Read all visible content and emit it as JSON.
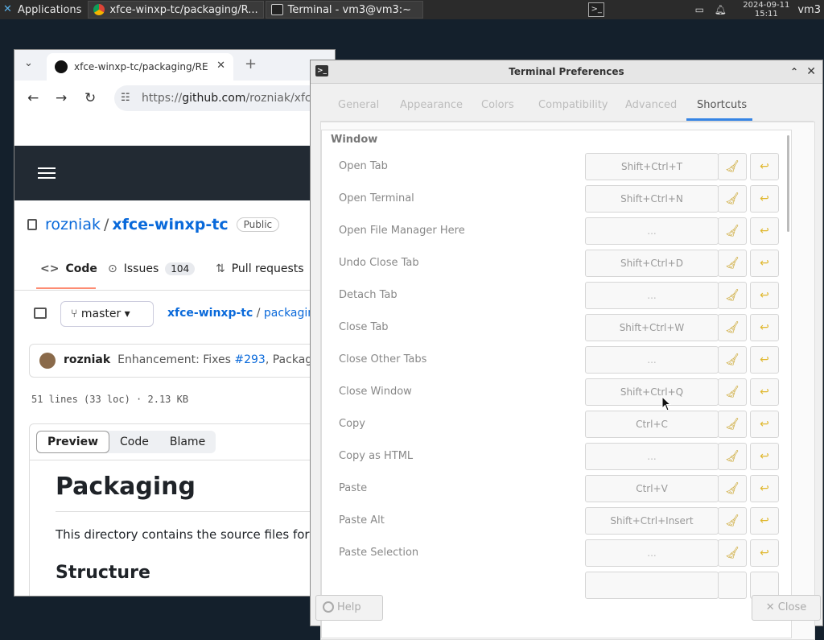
{
  "panel": {
    "apps_label": "Applications",
    "tasks": [
      {
        "label": "xfce-winxp-tc/packaging/R...",
        "kind": "chrome"
      },
      {
        "label": "Terminal - vm3@vm3:~",
        "kind": "terminal"
      }
    ],
    "date": "2024-09-11",
    "time": "15:11",
    "user": "vm3"
  },
  "browser": {
    "tab_title": "xfce-winxp-tc/packaging/RE",
    "url_prefix": "https://",
    "url_host": "github.com",
    "url_rest": "/rozniak/xfce-w",
    "repo_owner": "rozniak",
    "repo_name": "xfce-winxp-tc",
    "visibility": "Public",
    "nav": {
      "code": "Code",
      "issues": "Issues",
      "issues_count": "104",
      "pulls": "Pull requests"
    },
    "branch": "master",
    "path_repo": "xfce-winxp-tc",
    "path_rest": "packagin",
    "commit_author": "rozniak",
    "commit_text_1": "Enhancement: Fixes ",
    "commit_link": "#293",
    "commit_text_2": ", Packaging po",
    "file_info": "51 lines (33 loc) · 2.13 KB",
    "view_tabs": [
      "Preview",
      "Code",
      "Blame"
    ],
    "h1": "Packaging",
    "paragraph": "This directory contains the source files for pa",
    "h2": "Structure"
  },
  "dialog": {
    "title": "Terminal Preferences",
    "tabs": [
      "General",
      "Appearance",
      "Colors",
      "Compatibility",
      "Advanced",
      "Shortcuts"
    ],
    "active_tab": "Shortcuts",
    "section": "Window",
    "shortcuts": [
      {
        "label": "Open Tab",
        "accel": "Shift+Ctrl+T"
      },
      {
        "label": "Open Terminal",
        "accel": "Shift+Ctrl+N"
      },
      {
        "label": "Open File Manager Here",
        "accel": "..."
      },
      {
        "label": "Undo Close Tab",
        "accel": "Shift+Ctrl+D"
      },
      {
        "label": "Detach Tab",
        "accel": "..."
      },
      {
        "label": "Close Tab",
        "accel": "Shift+Ctrl+W"
      },
      {
        "label": "Close Other Tabs",
        "accel": "..."
      },
      {
        "label": "Close Window",
        "accel": "Shift+Ctrl+Q"
      },
      {
        "label": "Copy",
        "accel": "Ctrl+C"
      },
      {
        "label": "Copy as HTML",
        "accel": "..."
      },
      {
        "label": "Paste",
        "accel": "Ctrl+V"
      },
      {
        "label": "Paste Alt",
        "accel": "Shift+Ctrl+Insert"
      },
      {
        "label": "Paste Selection",
        "accel": "..."
      }
    ],
    "help_label": "Help",
    "close_label": "Close"
  }
}
